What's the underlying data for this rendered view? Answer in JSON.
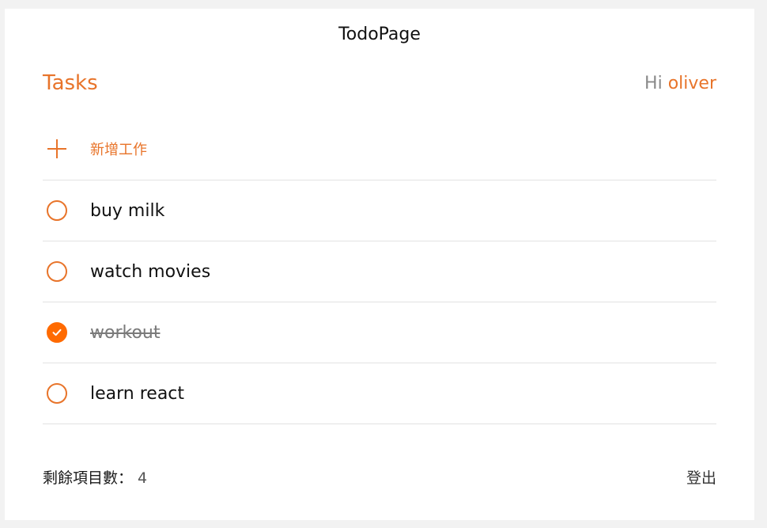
{
  "app": {
    "title": "TodoPage"
  },
  "header": {
    "heading": "Tasks",
    "greeting_prefix": "Hi ",
    "username": "oliver"
  },
  "add_task": {
    "label": "新增工作",
    "icon": "plus-icon"
  },
  "tasks": [
    {
      "text": "buy milk",
      "done": false
    },
    {
      "text": "watch movies",
      "done": false
    },
    {
      "text": "workout",
      "done": true
    },
    {
      "text": "learn react",
      "done": false
    }
  ],
  "footer": {
    "remaining_label": "剩餘項目數：",
    "remaining_count": "4",
    "logout_label": "登出"
  },
  "colors": {
    "accent": "#e8742a",
    "checked": "#ff6a00",
    "divider": "#e2e2e2"
  }
}
